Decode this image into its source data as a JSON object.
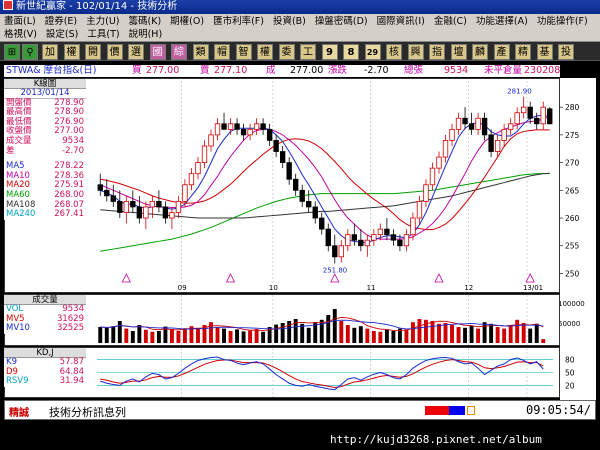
{
  "window": {
    "title": "新世紀贏家 - 102/01/14 - 技術分析"
  },
  "menu": {
    "row1": [
      "畫面(L)",
      "證券(E)",
      "主力(U)",
      "籌碼(K)",
      "期權(O)",
      "匯市利率(F)",
      "投資(B)",
      "操盤密碼(D)",
      "國際資訊(I)",
      "金融(C)",
      "功能選擇(A)",
      "功能操作(F)"
    ],
    "row2": [
      "格視(V)",
      "設定(S)",
      "工具(T)",
      "說明(H)"
    ]
  },
  "toolbar": {
    "buttons": [
      "加",
      "權",
      "開",
      "價",
      "選",
      "國",
      "綜",
      "類",
      "帽",
      "智",
      "權",
      "委",
      "工",
      "9",
      "8",
      "29",
      "核",
      "興",
      "指",
      "壇",
      "麟",
      "產",
      "精",
      "基",
      "投"
    ]
  },
  "quote": {
    "symbol": "STWA& 摩台指&(日)",
    "bid_label": "買",
    "bid": "277.00",
    "ask_label": "賣",
    "ask": "277.10",
    "last_label": "成",
    "last": "277.00",
    "change_label": "漲跌",
    "change": "-2.70",
    "volume_label": "總張",
    "volume": "9534",
    "oi_label": "未平倉量",
    "oi": "230208"
  },
  "kbox": {
    "title": "K線圖",
    "date": "2013/01/14",
    "rows": [
      {
        "label": "開盤價",
        "value": "278.90",
        "color": "#d0105a"
      },
      {
        "label": "最高價",
        "value": "278.90",
        "color": "#d0105a"
      },
      {
        "label": "最低價",
        "value": "276.90",
        "color": "#d0105a"
      },
      {
        "label": "收盤價",
        "value": "277.00",
        "color": "#d0105a"
      },
      {
        "label": "成交量",
        "value": "9534",
        "color": "#d0105a"
      },
      {
        "label": "差",
        "value": "-2.70",
        "color": "#d0105a"
      }
    ],
    "ma": [
      {
        "label": "MA5",
        "value": "278.22",
        "color": "#1a2acc"
      },
      {
        "label": "MA10",
        "value": "278.36",
        "color": "#c000a0"
      },
      {
        "label": "MA20",
        "value": "275.91",
        "color": "#d00000"
      },
      {
        "label": "MA60",
        "value": "268.00",
        "color": "#00a000"
      },
      {
        "label": "MA108",
        "value": "268.07",
        "color": "#333333"
      },
      {
        "label": "MA240",
        "value": "267.41",
        "color": "#00a0c0"
      }
    ]
  },
  "vbox": {
    "title": "成交量",
    "rows": [
      {
        "label": "VOL",
        "value": "9534",
        "color": "#00a0c0"
      },
      {
        "label": "MV5",
        "value": "31629",
        "color": "#d00000"
      },
      {
        "label": "MV10",
        "value": "32525",
        "color": "#1a2acc"
      }
    ]
  },
  "kdbox": {
    "title": "KD,J",
    "rows": [
      {
        "label": "K9",
        "value": "57.87",
        "color": "#1a2acc"
      },
      {
        "label": "D9",
        "value": "64.84",
        "color": "#d00000"
      },
      {
        "label": "RSV9",
        "value": "31.94",
        "color": "#00a0c0"
      }
    ]
  },
  "axis": {
    "price_ticks": [
      "280",
      "275",
      "270",
      "265",
      "260",
      "255",
      "250"
    ],
    "volume_ticks": [
      "100000",
      "50000"
    ],
    "kd_ticks": [
      "80",
      "50",
      "20"
    ],
    "month_labels": [
      "09",
      "10",
      "11",
      "12",
      "13/01"
    ]
  },
  "annotations": {
    "high": "281.90",
    "low": "251.80"
  },
  "status": {
    "label": "精誠",
    "message": "技術分析訊息列",
    "time": "09:05:54/"
  },
  "watermark": "http://kujd3268.pixnet.net/album",
  "colors": {
    "up": "#d00000",
    "down": "#000000",
    "ma5": "#1a2acc",
    "ma10": "#c000a0",
    "ma20": "#d00000",
    "ma60": "#00a000",
    "ma108": "#333333"
  },
  "chart_data": {
    "type": "candlestick",
    "title": "",
    "ylim": [
      249,
      284
    ],
    "candles": [
      {
        "o": 266,
        "h": 268,
        "l": 264,
        "c": 265
      },
      {
        "o": 265,
        "h": 267,
        "l": 263,
        "c": 264
      },
      {
        "o": 264,
        "h": 266,
        "l": 262,
        "c": 263
      },
      {
        "o": 263,
        "h": 265,
        "l": 260,
        "c": 261
      },
      {
        "o": 261,
        "h": 264,
        "l": 259,
        "c": 263
      },
      {
        "o": 263,
        "h": 265,
        "l": 261,
        "c": 262
      },
      {
        "o": 262,
        "h": 264,
        "l": 259,
        "c": 260
      },
      {
        "o": 260,
        "h": 263,
        "l": 258,
        "c": 262
      },
      {
        "o": 262,
        "h": 264,
        "l": 260,
        "c": 263
      },
      {
        "o": 263,
        "h": 265,
        "l": 261,
        "c": 262
      },
      {
        "o": 262,
        "h": 263,
        "l": 259,
        "c": 260
      },
      {
        "o": 260,
        "h": 262,
        "l": 258,
        "c": 261
      },
      {
        "o": 261,
        "h": 264,
        "l": 260,
        "c": 263
      },
      {
        "o": 263,
        "h": 267,
        "l": 262,
        "c": 266
      },
      {
        "o": 266,
        "h": 269,
        "l": 265,
        "c": 268
      },
      {
        "o": 268,
        "h": 271,
        "l": 267,
        "c": 270
      },
      {
        "o": 270,
        "h": 274,
        "l": 269,
        "c": 273
      },
      {
        "o": 273,
        "h": 276,
        "l": 272,
        "c": 275
      },
      {
        "o": 275,
        "h": 278,
        "l": 274,
        "c": 277
      },
      {
        "o": 277,
        "h": 279,
        "l": 276,
        "c": 276
      },
      {
        "o": 276,
        "h": 278,
        "l": 275,
        "c": 277
      },
      {
        "o": 277,
        "h": 278,
        "l": 275,
        "c": 276
      },
      {
        "o": 276,
        "h": 277,
        "l": 274,
        "c": 275
      },
      {
        "o": 275,
        "h": 277,
        "l": 274,
        "c": 276
      },
      {
        "o": 276,
        "h": 278,
        "l": 275,
        "c": 277
      },
      {
        "o": 277,
        "h": 278,
        "l": 275,
        "c": 276
      },
      {
        "o": 276,
        "h": 277,
        "l": 273,
        "c": 274
      },
      {
        "o": 274,
        "h": 275,
        "l": 271,
        "c": 272
      },
      {
        "o": 272,
        "h": 273,
        "l": 269,
        "c": 270
      },
      {
        "o": 270,
        "h": 271,
        "l": 266,
        "c": 267
      },
      {
        "o": 267,
        "h": 268,
        "l": 264,
        "c": 265
      },
      {
        "o": 265,
        "h": 266,
        "l": 262,
        "c": 263
      },
      {
        "o": 263,
        "h": 265,
        "l": 261,
        "c": 262
      },
      {
        "o": 262,
        "h": 263,
        "l": 259,
        "c": 260
      },
      {
        "o": 260,
        "h": 261,
        "l": 257,
        "c": 258
      },
      {
        "o": 258,
        "h": 259,
        "l": 254,
        "c": 255
      },
      {
        "o": 255,
        "h": 257,
        "l": 251.8,
        "c": 253
      },
      {
        "o": 253,
        "h": 256,
        "l": 252,
        "c": 255
      },
      {
        "o": 255,
        "h": 258,
        "l": 254,
        "c": 257
      },
      {
        "o": 257,
        "h": 259,
        "l": 255,
        "c": 256
      },
      {
        "o": 256,
        "h": 258,
        "l": 254,
        "c": 255
      },
      {
        "o": 255,
        "h": 257,
        "l": 253,
        "c": 256
      },
      {
        "o": 256,
        "h": 258,
        "l": 255,
        "c": 257
      },
      {
        "o": 257,
        "h": 259,
        "l": 256,
        "c": 258
      },
      {
        "o": 258,
        "h": 260,
        "l": 256,
        "c": 257
      },
      {
        "o": 257,
        "h": 258,
        "l": 255,
        "c": 256
      },
      {
        "o": 256,
        "h": 257,
        "l": 254,
        "c": 255
      },
      {
        "o": 255,
        "h": 258,
        "l": 254,
        "c": 257
      },
      {
        "o": 257,
        "h": 261,
        "l": 256,
        "c": 260
      },
      {
        "o": 260,
        "h": 264,
        "l": 259,
        "c": 263
      },
      {
        "o": 263,
        "h": 267,
        "l": 262,
        "c": 266
      },
      {
        "o": 266,
        "h": 270,
        "l": 265,
        "c": 269
      },
      {
        "o": 269,
        "h": 272,
        "l": 268,
        "c": 271
      },
      {
        "o": 271,
        "h": 275,
        "l": 270,
        "c": 274
      },
      {
        "o": 274,
        "h": 277,
        "l": 273,
        "c": 276
      },
      {
        "o": 276,
        "h": 279,
        "l": 275,
        "c": 278
      },
      {
        "o": 278,
        "h": 280,
        "l": 276,
        "c": 277
      },
      {
        "o": 277,
        "h": 279,
        "l": 275,
        "c": 276
      },
      {
        "o": 276,
        "h": 279,
        "l": 275,
        "c": 278
      },
      {
        "o": 278,
        "h": 279,
        "l": 274,
        "c": 275
      },
      {
        "o": 275,
        "h": 276,
        "l": 271,
        "c": 272
      },
      {
        "o": 272,
        "h": 275,
        "l": 271,
        "c": 274
      },
      {
        "o": 274,
        "h": 277,
        "l": 273,
        "c": 276
      },
      {
        "o": 276,
        "h": 278,
        "l": 275,
        "c": 277
      },
      {
        "o": 277,
        "h": 280,
        "l": 276,
        "c": 279
      },
      {
        "o": 279,
        "h": 281.9,
        "l": 278,
        "c": 280
      },
      {
        "o": 280,
        "h": 281,
        "l": 277,
        "c": 278
      },
      {
        "o": 278,
        "h": 279,
        "l": 276,
        "c": 277
      },
      {
        "o": 277,
        "h": 281,
        "l": 276,
        "c": 280
      },
      {
        "o": 279.7,
        "h": 280,
        "l": 276.9,
        "c": 277
      }
    ],
    "ma5": [
      265,
      264.5,
      264,
      263,
      262.5,
      262.5,
      262,
      261.8,
      262,
      262.2,
      261.8,
      261.6,
      261.8,
      262.5,
      264,
      265.5,
      267.5,
      270,
      272.5,
      274.2,
      275.6,
      276.2,
      276.2,
      276.2,
      276.2,
      276.2,
      276,
      275,
      273.8,
      272,
      270,
      267.8,
      266,
      264,
      262,
      260,
      258,
      256.8,
      256,
      255.8,
      255.6,
      255.6,
      256,
      256.5,
      256.8,
      256.8,
      256.6,
      256.4,
      257.2,
      258.8,
      261,
      263.8,
      266.6,
      269.4,
      272,
      274.6,
      276.2,
      277,
      277.2,
      276.8,
      275.6,
      275,
      274.8,
      274.8,
      275.6,
      277,
      278,
      278.4,
      278.6,
      278.2
    ],
    "ma10": [
      266,
      265.5,
      265,
      264.5,
      264,
      263.5,
      263,
      262.5,
      262.2,
      262,
      262,
      261.9,
      261.9,
      262,
      262.3,
      263,
      264.2,
      265.9,
      267.5,
      269.4,
      271.1,
      272.6,
      274,
      275.2,
      275.8,
      276,
      276,
      275.6,
      275,
      274.1,
      273.1,
      271.9,
      270.6,
      269.1,
      267.4,
      265.3,
      263.3,
      261.5,
      260,
      258.9,
      257.8,
      256.9,
      256.4,
      256.2,
      256.2,
      256.2,
      256.2,
      256.3,
      256.6,
      257.3,
      258,
      259,
      260.3,
      261.9,
      263.8,
      265.9,
      268,
      270.3,
      272.2,
      273.8,
      274.7,
      275.4,
      276,
      276.4,
      276.8,
      277.2,
      277.4,
      277.5,
      277.9,
      278.3
    ],
    "ma20": [
      267,
      266.8,
      266.5,
      266.2,
      265.8,
      265.4,
      265,
      264.5,
      264,
      263.6,
      263.3,
      263,
      262.8,
      262.7,
      262.7,
      262.8,
      263.1,
      263.6,
      264.3,
      265.2,
      266.1,
      267.2,
      268.4,
      269.5,
      270.5,
      271.5,
      272.4,
      273.2,
      273.8,
      274.2,
      274.3,
      274.2,
      273.9,
      273.3,
      272.5,
      271.4,
      270.2,
      268.9,
      267.5,
      266.3,
      265.3,
      264.3,
      263.4,
      262.6,
      261.8,
      260.8,
      259.7,
      258.9,
      258.3,
      258.1,
      257.9,
      257.9,
      258.3,
      258.9,
      259.9,
      261.2,
      262.6,
      264.1,
      265.7,
      267.4,
      269.2,
      271,
      272.9,
      274.3,
      275.2,
      275.6,
      275.8,
      275.9,
      275.9,
      275.9
    ],
    "ma60": [
      254,
      254.2,
      254.4,
      254.6,
      254.8,
      255,
      255.2,
      255.4,
      255.6,
      255.8,
      256,
      256.2,
      256.5,
      256.8,
      257.1,
      257.5,
      257.9,
      258.3,
      258.8,
      259.3,
      259.8,
      260.3,
      260.8,
      261.3,
      261.8,
      262.2,
      262.6,
      263,
      263.3,
      263.6,
      263.8,
      264,
      264.2,
      264.3,
      264.4,
      264.4,
      264.4,
      264.4,
      264.4,
      264.4,
      264.4,
      264.4,
      264.4,
      264.4,
      264.4,
      264.4,
      264.5,
      264.6,
      264.7,
      264.8,
      264.9,
      265,
      265.2,
      265.4,
      265.6,
      265.8,
      266,
      266.2,
      266.4,
      266.6,
      266.8,
      267,
      267.2,
      267.4,
      267.6,
      267.8,
      267.9,
      268,
      268,
      268
    ],
    "ma108": [
      261.5,
      261.4,
      261.3,
      261.2,
      261.1,
      261,
      260.9,
      260.8,
      260.7,
      260.6,
      260.5,
      260.4,
      260.3,
      260.2,
      260.1,
      260,
      260,
      260,
      260,
      260,
      260,
      260,
      260,
      260.1,
      260.2,
      260.3,
      260.4,
      260.5,
      260.6,
      260.7,
      260.8,
      260.9,
      261,
      261.1,
      261.2,
      261.2,
      261.3,
      261.4,
      261.5,
      261.6,
      261.7,
      261.8,
      261.9,
      262,
      262.1,
      262.2,
      262.4,
      262.6,
      262.8,
      263,
      263.2,
      263.4,
      263.6,
      263.8,
      264,
      264.3,
      264.6,
      264.9,
      265.2,
      265.5,
      265.8,
      266.1,
      266.4,
      266.7,
      267,
      267.3,
      267.6,
      267.8,
      268,
      268.07
    ],
    "volumes": [
      40000,
      38000,
      42000,
      55000,
      36000,
      30000,
      45000,
      33000,
      28000,
      30000,
      41000,
      35000,
      30000,
      37000,
      42000,
      38000,
      45000,
      52000,
      40000,
      36000,
      30000,
      34000,
      29000,
      31000,
      35000,
      28000,
      40000,
      46000,
      50000,
      55000,
      60000,
      48000,
      38000,
      52000,
      58000,
      70000,
      85000,
      55000,
      45000,
      38000,
      42000,
      36000,
      30000,
      28000,
      33000,
      30000,
      36000,
      34000,
      52000,
      60000,
      58000,
      55000,
      48000,
      50000,
      45000,
      40000,
      38000,
      44000,
      36000,
      52000,
      48000,
      40000,
      36000,
      45000,
      58000,
      50000,
      36000,
      48000,
      9534
    ],
    "k9": [
      30,
      25,
      22,
      20,
      30,
      35,
      28,
      40,
      48,
      45,
      35,
      38,
      48,
      60,
      70,
      78,
      82,
      85,
      86,
      80,
      78,
      72,
      68,
      72,
      75,
      70,
      58,
      45,
      35,
      25,
      20,
      18,
      22,
      18,
      15,
      12,
      10,
      22,
      35,
      38,
      32,
      40,
      46,
      50,
      45,
      38,
      35,
      45,
      60,
      70,
      78,
      82,
      84,
      85,
      83,
      75,
      70,
      72,
      60,
      45,
      55,
      65,
      70,
      80,
      84,
      78,
      70,
      75,
      57.87
    ],
    "d9": [
      35,
      32,
      28,
      25,
      27,
      30,
      30,
      33,
      38,
      41,
      39,
      39,
      42,
      48,
      55,
      62,
      69,
      74,
      78,
      79,
      79,
      76,
      73,
      73,
      73,
      72,
      67,
      60,
      52,
      43,
      35,
      29,
      26,
      23,
      21,
      18,
      15,
      17,
      23,
      28,
      30,
      33,
      37,
      41,
      43,
      41,
      39,
      41,
      47,
      55,
      63,
      69,
      74,
      78,
      80,
      78,
      75,
      74,
      69,
      61,
      59,
      61,
      64,
      69,
      74,
      75,
      73,
      73,
      64.84
    ]
  }
}
